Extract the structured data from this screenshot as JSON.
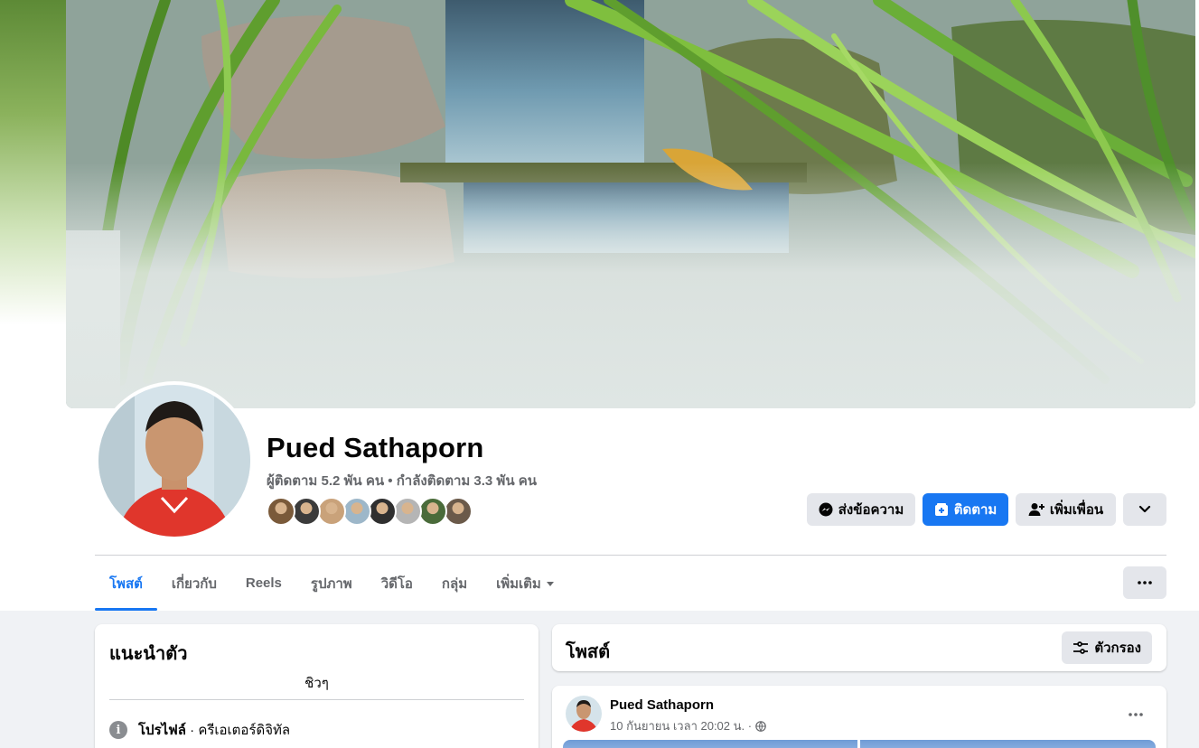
{
  "profile": {
    "name": "Pued Sathaporn",
    "stats": "ผู้ติดตาม 5.2 พัน คน • กำลังติดตาม 3.3 พัน คน",
    "friend_avatar_colors": [
      "#7a5a3a",
      "#3b3b3b",
      "#c9a27a",
      "#9db7c9",
      "#2f2f2f",
      "#b5b5b5",
      "#4a6b3a",
      "#6b5a4a"
    ]
  },
  "actions": {
    "message_label": "ส่งข้อความ",
    "follow_label": "ติดตาม",
    "add_friend_label": "เพิ่มเพื่อน"
  },
  "tabs": [
    {
      "label": "โพสต์",
      "active": true
    },
    {
      "label": "เกี่ยวกับ",
      "active": false
    },
    {
      "label": "Reels",
      "active": false
    },
    {
      "label": "รูปภาพ",
      "active": false
    },
    {
      "label": "วิดีโอ",
      "active": false
    },
    {
      "label": "กลุ่ม",
      "active": false
    },
    {
      "label": "เพิ่มเติม",
      "active": false
    }
  ],
  "intro": {
    "title": "แนะนำตัว",
    "bio": "ชิวๆ",
    "profile_label": "โปรไฟล์",
    "profile_value": " · ครีเอเตอร์ดิจิทัล"
  },
  "posts": {
    "title": "โพสต์",
    "filter_label": "ตัวกรอง"
  },
  "post": {
    "author": "Pued Sathaporn",
    "time": "10 กันยายน เวลา 20:02 น. ·"
  },
  "colors": {
    "accent": "#1877f2",
    "button_gray": "#e4e6eb",
    "muted_text": "#65676b",
    "page_bg": "#f0f2f5"
  }
}
